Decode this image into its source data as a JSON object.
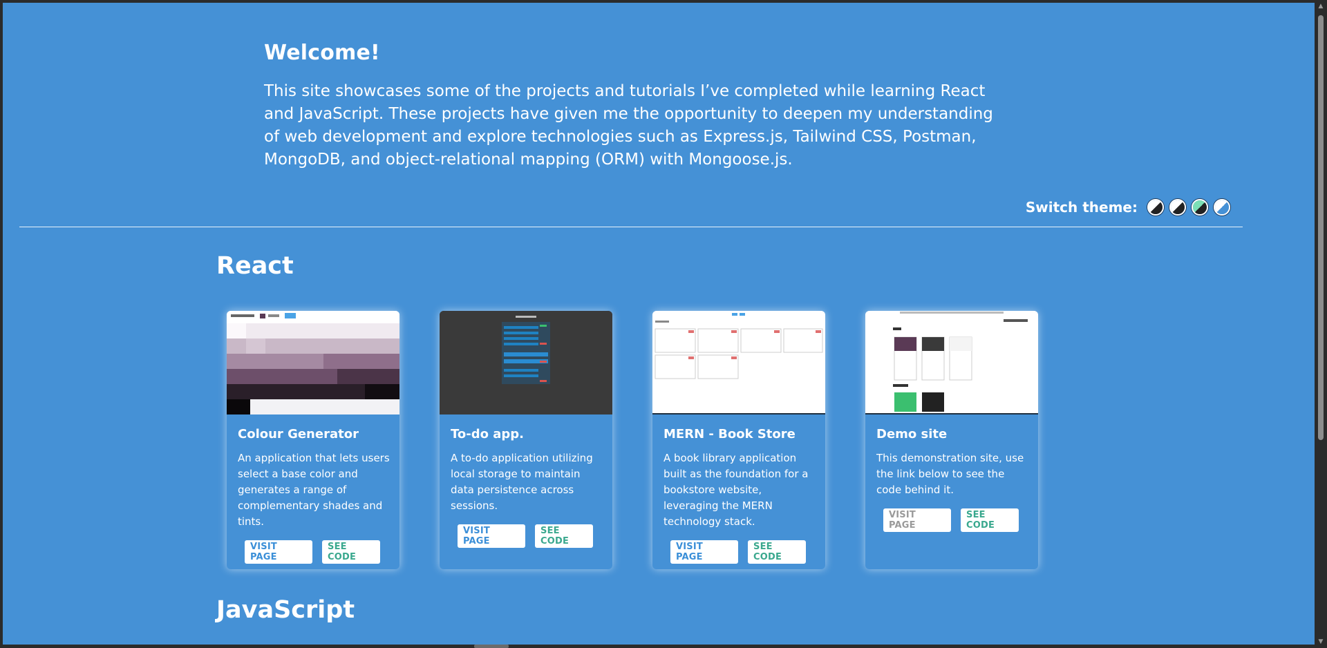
{
  "intro": {
    "heading": "Welcome!",
    "paragraph": "This site showcases some of the projects and tutorials I’ve completed while learning React and JavaScript. These projects have given me the opportunity to deepen my understanding of web development and explore technologies such as Express.js, Tailwind CSS, Postman, MongoDB, and object-relational mapping (ORM) with Mongoose.js."
  },
  "theme": {
    "label": "Switch theme:",
    "options": [
      {
        "name": "light-theme-icon",
        "left": "#ffffff",
        "right": "#222222"
      },
      {
        "name": "dark-theme-icon",
        "left": "#ffffff",
        "right": "#222222"
      },
      {
        "name": "green-theme-icon",
        "left": "#7be0b6",
        "right": "#222222"
      },
      {
        "name": "blue-theme-icon",
        "left": "#ffffff",
        "right": "#4591d6"
      }
    ]
  },
  "sections": {
    "react": "React",
    "javascript": "JavaScript"
  },
  "cards": [
    {
      "title": "Colour Generator",
      "description": "An application that lets users select a base color and generates a range of complementary shades and tints.",
      "visit_label": "VISIT PAGE",
      "code_label": "SEE CODE"
    },
    {
      "title": "To-do app.",
      "description": "A to-do application utilizing local storage to maintain data persistence across sessions.",
      "visit_label": "VISIT PAGE",
      "code_label": "SEE CODE"
    },
    {
      "title": "MERN - Book Store",
      "description": "A book library application built as the foundation for a bookstore website, leveraging the MERN technology stack.",
      "visit_label": "VISIT PAGE",
      "code_label": "SEE CODE"
    },
    {
      "title": "Demo site",
      "description": "This demonstration site, use the link below to see the code behind it.",
      "visit_label": "VISIT PAGE",
      "code_label": "SEE CODE"
    }
  ],
  "colors": {
    "background": "#4591d6",
    "visit_text": "#3b8fd8",
    "code_text": "#3aa88e"
  }
}
